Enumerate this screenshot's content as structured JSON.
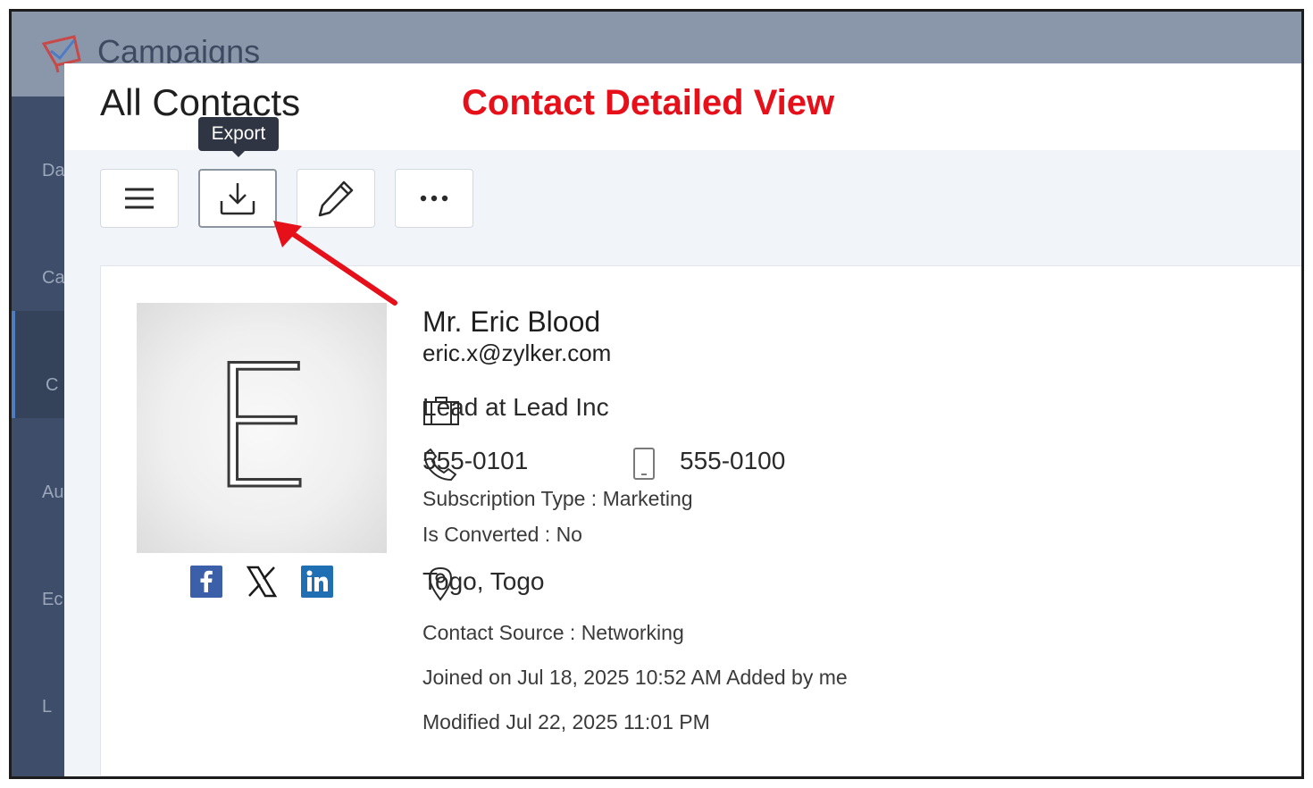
{
  "app": {
    "title": "Campaigns"
  },
  "sidebar": {
    "items": [
      {
        "label": "Da"
      },
      {
        "label": "Ca"
      },
      {
        "label": "C"
      },
      {
        "label": "Au"
      },
      {
        "label": "Ec"
      },
      {
        "label": "L"
      }
    ]
  },
  "header": {
    "title": "All Contacts",
    "annotation": "Contact Detailed View"
  },
  "toolbar": {
    "tooltip": "Export",
    "buttons": [
      {
        "icon": "menu-icon"
      },
      {
        "icon": "export-icon"
      },
      {
        "icon": "edit-icon"
      },
      {
        "icon": "more-icon"
      }
    ]
  },
  "contact": {
    "avatar_letter": "E",
    "name": "Mr. Eric Blood",
    "email": "eric.x@zylker.com",
    "job": "Lead at Lead Inc",
    "phone": "555-0101",
    "mobile": "555-0100",
    "subscription": "Subscription Type : Marketing",
    "converted": "Is Converted : No",
    "location": "Togo, Togo",
    "source": "Contact Source  : Networking",
    "joined": "Joined on Jul 18, 2025 10:52 AM Added by me",
    "modified": "Modified Jul 22, 2025 11:01 PM",
    "socials": [
      {
        "icon": "facebook-icon",
        "label": "f"
      },
      {
        "icon": "x-icon",
        "label": "X"
      },
      {
        "icon": "linkedin-icon",
        "label": "in"
      }
    ]
  },
  "colors": {
    "annotation": "#e5101a",
    "facebook": "#3b5fa8",
    "linkedin": "#1f6fb2",
    "sidebar": "#3e4e6a"
  }
}
